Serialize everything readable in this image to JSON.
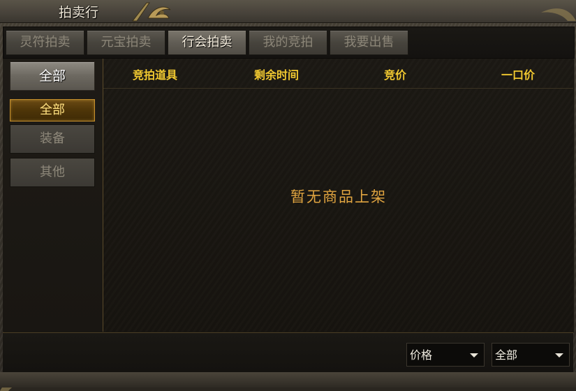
{
  "window": {
    "title": "拍卖行"
  },
  "tabs": [
    {
      "label": "灵符拍卖",
      "active": false
    },
    {
      "label": "元宝拍卖",
      "active": false
    },
    {
      "label": "行会拍卖",
      "active": true
    },
    {
      "label": "我的竞拍",
      "active": false
    },
    {
      "label": "我要出售",
      "active": false
    }
  ],
  "sidebar": {
    "main_label": "全部",
    "items": [
      {
        "label": "全部",
        "selected": true
      },
      {
        "label": "装备",
        "selected": false
      },
      {
        "label": "其他",
        "selected": false
      }
    ]
  },
  "table": {
    "columns": [
      "竞拍道具",
      "剩余时间",
      "竞价",
      "一口价"
    ],
    "empty_message": "暂无商品上架"
  },
  "filters": {
    "sort": {
      "selected": "价格"
    },
    "category": {
      "selected": "全部"
    }
  },
  "colors": {
    "header_text": "#f0c830",
    "empty_text": "#e0a440",
    "selected_item_border": "#c8902c"
  }
}
